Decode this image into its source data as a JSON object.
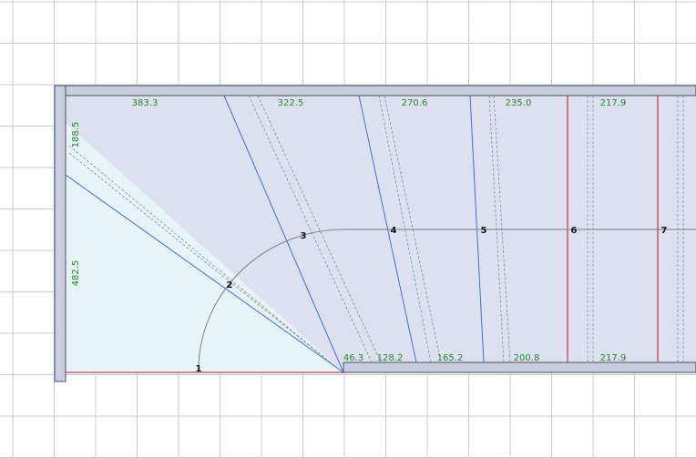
{
  "colors": {
    "grid": "#c6c9dd",
    "wall_fill": "#c7cddd",
    "wall_stroke": "#4a4f66",
    "floor": "#dde1ef",
    "winder_zone": "#e6f4f8",
    "blue_line": "#3d6ee0",
    "red_line": "#c8102e",
    "dashed_line": "#8a8a95",
    "walk_line": "#808080",
    "dimension_text": "#1e8c1e",
    "step_number": "#111111"
  },
  "top_dimensions": [
    "383.3",
    "322.5",
    "270.6",
    "235.0",
    "217.9"
  ],
  "bottom_dimensions": [
    "46.3",
    "128.2",
    "165.2",
    "200.8",
    "217.9"
  ],
  "left_dimensions": [
    "188.5",
    "482.5"
  ],
  "step_numbers": [
    "1",
    "2",
    "3",
    "4",
    "5",
    "6",
    "7"
  ]
}
